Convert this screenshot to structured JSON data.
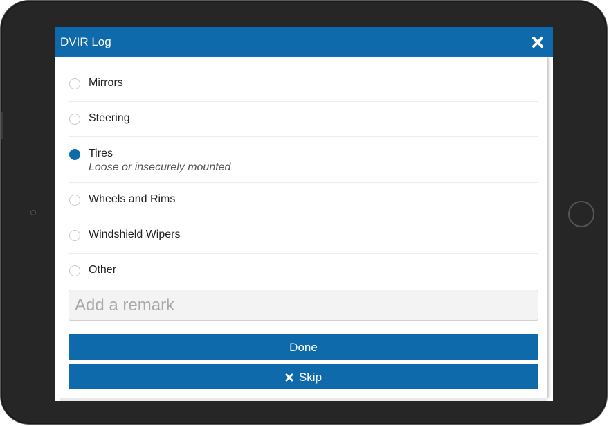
{
  "dialog": {
    "title": "DVIR Log"
  },
  "options": [
    {
      "label": "Mirrors",
      "sub": "",
      "checked": false
    },
    {
      "label": "Steering",
      "sub": "",
      "checked": false
    },
    {
      "label": "Tires",
      "sub": "Loose or insecurely mounted",
      "checked": true
    },
    {
      "label": "Wheels and Rims",
      "sub": "",
      "checked": false
    },
    {
      "label": "Windshield Wipers",
      "sub": "",
      "checked": false
    },
    {
      "label": "Other",
      "sub": "",
      "checked": false
    }
  ],
  "remark": {
    "placeholder": "Add a remark",
    "value": ""
  },
  "buttons": {
    "done_label": "Done",
    "skip_label": "Skip"
  },
  "icons": {
    "close": "close-icon",
    "skip": "x-icon"
  },
  "colors": {
    "accent": "#0f6aab",
    "device_frame": "#262626"
  }
}
